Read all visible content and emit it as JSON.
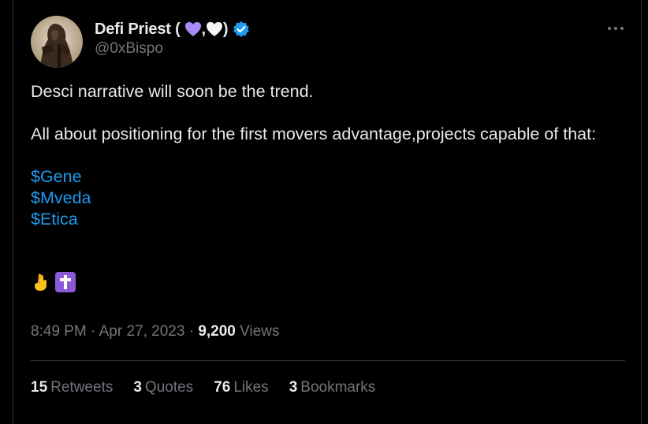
{
  "author": {
    "display_name": "Defi Priest (",
    "name_comma": ",",
    "name_close": ")",
    "handle": "@0xBispo",
    "heart_colors": [
      "#a78bfa",
      "#ffffff"
    ],
    "verified_color": "#1d9bf0"
  },
  "tweet": {
    "line1": "Desci narrative will soon be the trend.",
    "line2": "All about positioning for the first movers advantage,projects capable of that:",
    "cashtags": [
      "$Gene",
      "$Mveda",
      "$Etica"
    ],
    "emojis": [
      "crossed-fingers-icon",
      "latin-cross-icon"
    ]
  },
  "meta": {
    "time": "8:49 PM",
    "separator": "·",
    "date": "Apr 27, 2023",
    "views_count": "9,200",
    "views_label": "Views"
  },
  "stats": [
    {
      "count": "15",
      "label": "Retweets"
    },
    {
      "count": "3",
      "label": "Quotes"
    },
    {
      "count": "76",
      "label": "Likes"
    },
    {
      "count": "3",
      "label": "Bookmarks"
    }
  ],
  "colors": {
    "background": "#000000",
    "text": "#e7e9ea",
    "secondary": "#71767b",
    "link": "#1d9bf0",
    "border": "#2f3336"
  }
}
